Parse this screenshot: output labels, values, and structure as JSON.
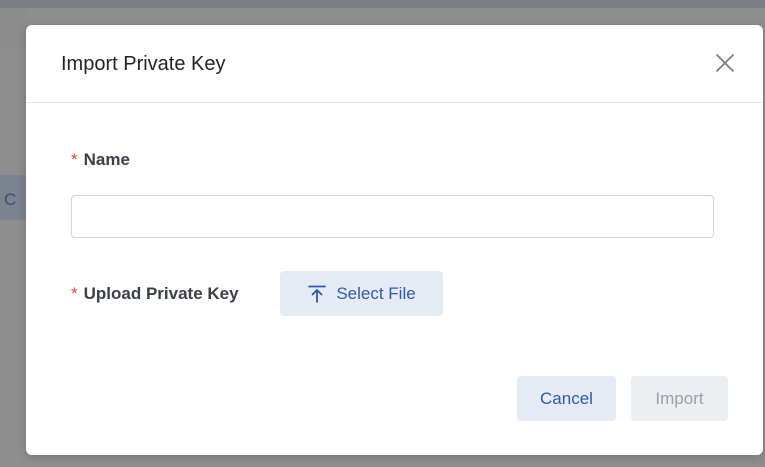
{
  "background": {
    "edge_text": "C"
  },
  "dialog": {
    "title": "Import Private Key",
    "close_icon": "close-icon",
    "fields": {
      "name": {
        "required_mark": "*",
        "label": "Name",
        "value": "",
        "placeholder": ""
      },
      "upload": {
        "required_mark": "*",
        "label": "Upload Private Key",
        "button_icon": "upload-icon",
        "button_label": "Select File"
      }
    },
    "footer": {
      "cancel_label": "Cancel",
      "import_label": "Import"
    }
  },
  "colors": {
    "accent": "#2f5aa8",
    "required": "#e0453a",
    "button_bg": "#e6eaf5",
    "disabled_text": "#9aa0a8"
  }
}
